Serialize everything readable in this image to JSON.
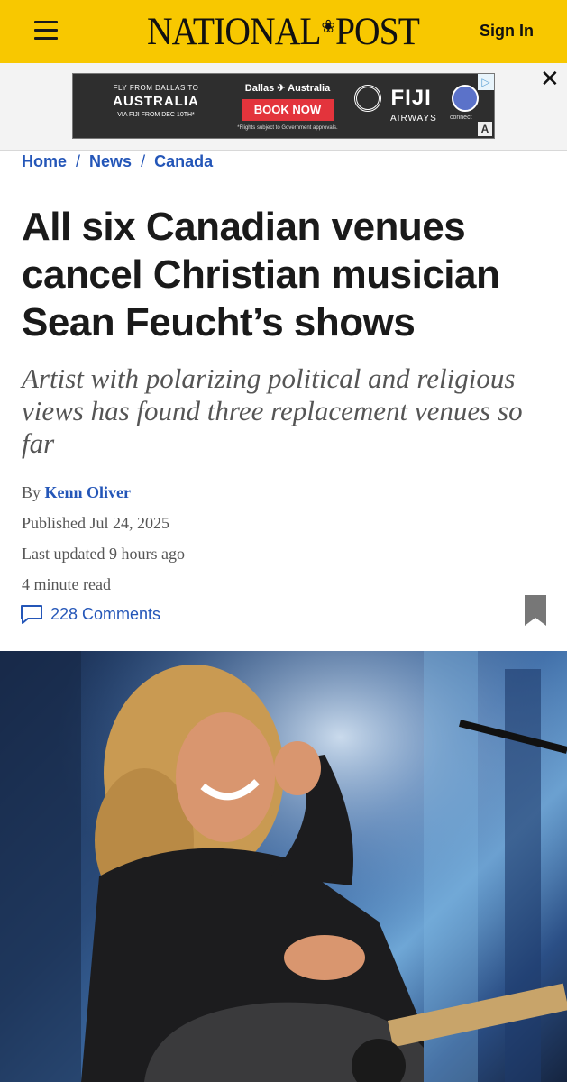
{
  "header": {
    "logo_left": "NATIONAL",
    "logo_right": "POST",
    "sign_in": "Sign In"
  },
  "ad": {
    "line1": "FLY FROM DALLAS TO",
    "line2": "AUSTRALIA",
    "line3": "VIA FIJI FROM DEC 10TH*",
    "route": "Dallas ✈ Australia",
    "cta": "BOOK NOW",
    "fine_print": "*Flights subject to Government approvals.",
    "brand": "FIJI",
    "brand_sub": "AIRWAYS",
    "partner": "connect"
  },
  "breadcrumb": [
    "Home",
    "News",
    "Canada"
  ],
  "article": {
    "headline": "All six Canadian venues cancel Christian musician Sean Feucht’s shows",
    "subhead": "Artist with polarizing political and religious views has found three replacement venues so far",
    "by_label": "By",
    "author": "Kenn Oliver",
    "published": "Published Jul 24, 2025",
    "updated": "Last updated 9 hours ago",
    "read_time": "4 minute read",
    "comments": "228 Comments"
  },
  "colors": {
    "brand_yellow": "#f8c800",
    "link_blue": "#2456b8",
    "ad_red": "#e3343c"
  }
}
